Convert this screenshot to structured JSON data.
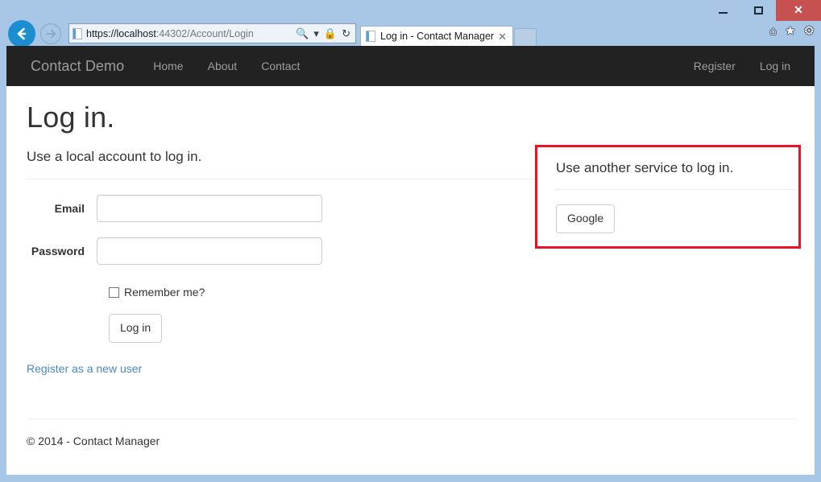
{
  "window": {
    "minimize_label": "–",
    "maximize_label": "",
    "close_label": "✕"
  },
  "browser": {
    "back_icon": "back-arrow-icon",
    "forward_icon": "forward-arrow-icon",
    "address": {
      "url_host": "https://localhost",
      "url_path": ":44302/Account/Login",
      "search_icon": "🔍",
      "dropdown_icon": "▾",
      "lock_icon": "🔒",
      "refresh_icon": "↻"
    },
    "tab": {
      "title": "Log in - Contact Manager",
      "close_label": "✕"
    },
    "toolbar": {
      "home_icon": "⌂",
      "favorites_icon": "★",
      "settings_icon": "⚙"
    }
  },
  "site_nav": {
    "brand": "Contact Demo",
    "links": [
      {
        "label": "Home"
      },
      {
        "label": "About"
      },
      {
        "label": "Contact"
      }
    ],
    "right_links": [
      {
        "label": "Register"
      },
      {
        "label": "Log in"
      }
    ]
  },
  "main": {
    "page_title": "Log in.",
    "local_section": {
      "heading": "Use a local account to log in.",
      "fields": [
        {
          "label": "Email",
          "value": "",
          "placeholder": "",
          "type": "text"
        },
        {
          "label": "Password",
          "value": "",
          "placeholder": "",
          "type": "password"
        }
      ],
      "remember_label": "Remember me?",
      "remember_checked": false,
      "submit_label": "Log in",
      "register_link": "Register as a new user"
    },
    "external_section": {
      "heading": "Use another service to log in.",
      "providers": [
        {
          "label": "Google"
        }
      ],
      "highlight_color": "#e81425"
    }
  },
  "footer": {
    "text": "© 2014 - Contact Manager"
  }
}
